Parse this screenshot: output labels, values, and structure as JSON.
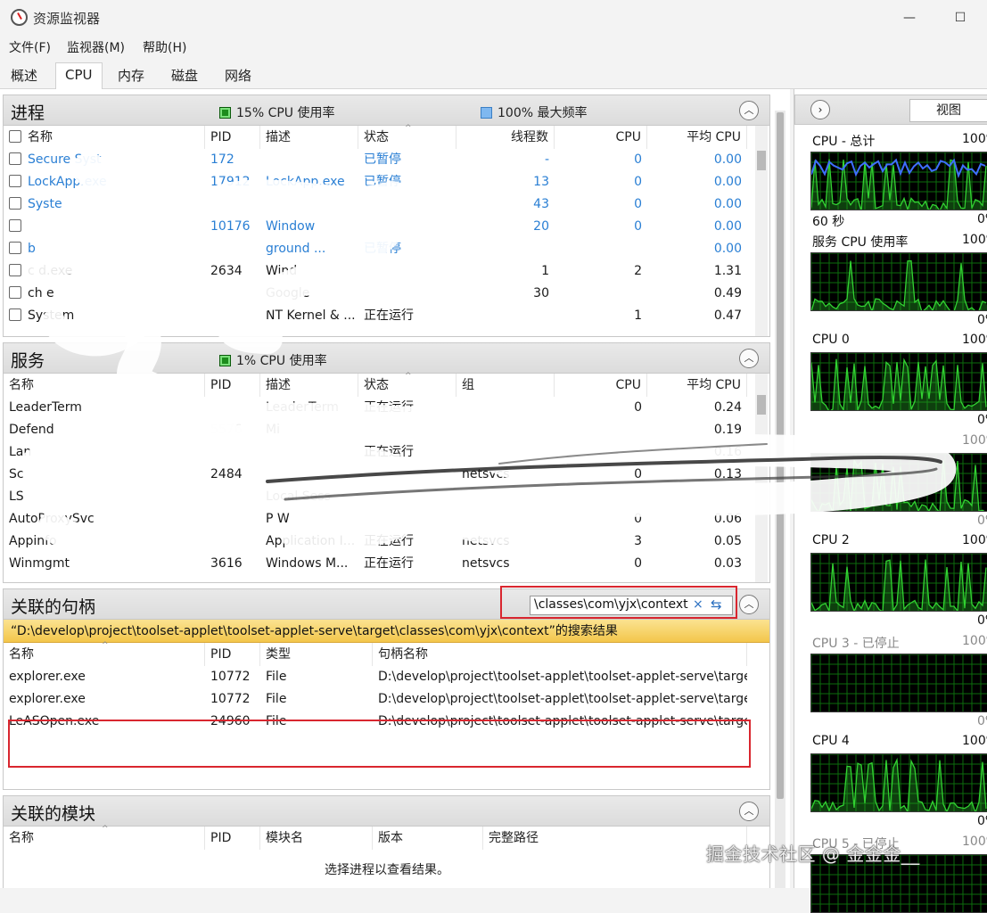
{
  "window": {
    "title": "资源监视器",
    "minimize": "—",
    "maximize": "☐"
  },
  "menu": [
    "文件(F)",
    "监视器(M)",
    "帮助(H)"
  ],
  "tabs": [
    "概述",
    "CPU",
    "内存",
    "磁盘",
    "网络"
  ],
  "active_tab": "CPU",
  "processes": {
    "title": "进程",
    "cpu_usage": "15% CPU 使用率",
    "max_freq": "100% 最大频率",
    "columns": [
      "名称",
      "PID",
      "描述",
      "状态",
      "线程数",
      "CPU",
      "平均 CPU"
    ],
    "rows": [
      {
        "name": "Secure Syst",
        "pid": "172",
        "desc": "",
        "status": "已暂停",
        "threads": "-",
        "cpu": "0",
        "avg": "0.00",
        "suspended": true
      },
      {
        "name": "LockApp.exe",
        "pid": "17912",
        "desc": "LockApp.exe",
        "status": "已暂停",
        "threads": "13",
        "cpu": "0",
        "avg": "0.00",
        "suspended": true
      },
      {
        "name": "Syste",
        "pid": "",
        "desc": "",
        "status": "",
        "threads": "43",
        "cpu": "0",
        "avg": "0.00",
        "suspended": true
      },
      {
        "name": "",
        "pid": "10176",
        "desc": "Window",
        "status": "",
        "threads": "20",
        "cpu": "0",
        "avg": "0.00",
        "suspended": true
      },
      {
        "name": "b",
        "pid": "",
        "desc": "ground ...",
        "status": "已暂停",
        "threads": "",
        "cpu": "",
        "avg": "0.00",
        "suspended": true
      },
      {
        "name": "c   d.exe",
        "pid": "2634",
        "desc": "Wind",
        "status": "",
        "threads": "1",
        "cpu": "2",
        "avg": "1.31",
        "suspended": false
      },
      {
        "name": "ch      e",
        "pid": "",
        "desc": "Google",
        "status": "",
        "threads": "30",
        "cpu": "",
        "avg": "0.49",
        "suspended": false
      },
      {
        "name": "System",
        "pid": "",
        "desc": "NT Kernel & ...",
        "status": "正在运行",
        "threads": "",
        "cpu": "1",
        "avg": "0.47",
        "suspended": false
      }
    ]
  },
  "services": {
    "title": "服务",
    "cpu_usage": "1% CPU 使用率",
    "columns": [
      "名称",
      "PID",
      "描述",
      "状态",
      "组",
      "CPU",
      "平均 CPU"
    ],
    "rows": [
      {
        "name": "LeaderTerm",
        "pid": "",
        "desc": "LeaderTerm",
        "status": "正在运行",
        "group": "",
        "cpu": "0",
        "avg": "0.24"
      },
      {
        "name": "Defend",
        "pid": "5576",
        "desc": "Mi",
        "status": "",
        "group": "",
        "cpu": "",
        "avg": "0.19"
      },
      {
        "name": "Lan",
        "pid": "",
        "desc": "",
        "status": "正在运行",
        "group": "",
        "cpu": "",
        "avg": "0.16"
      },
      {
        "name": "Sc",
        "pid": "2484",
        "desc": "",
        "status": "",
        "group": "netsvcs",
        "cpu": "0",
        "avg": "0.13"
      },
      {
        "name": "LS",
        "pid": "",
        "desc": "Local Sess",
        "status": "",
        "group": "",
        "cpu": "",
        "avg": ""
      },
      {
        "name": "AutoProxySvc",
        "pid": "",
        "desc": "P W",
        "status": "",
        "group": "",
        "cpu": "0",
        "avg": "0.06"
      },
      {
        "name": "Appinfo",
        "pid": "",
        "desc": "Application I...",
        "status": "正在运行",
        "group": "netsvcs",
        "cpu": "3",
        "avg": "0.05"
      },
      {
        "name": "Winmgmt",
        "pid": "3616",
        "desc": "Windows M...",
        "status": "正在运行",
        "group": "netsvcs",
        "cpu": "0",
        "avg": "0.03"
      }
    ]
  },
  "handles": {
    "title": "关联的句柄",
    "search_value": "\\classes\\com\\yjx\\context",
    "clear": "×",
    "refresh": "⇆",
    "result_text": "“D:\\develop\\project\\toolset-applet\\toolset-applet-serve\\target\\classes\\com\\yjx\\context”的搜索结果",
    "columns": [
      "名称",
      "PID",
      "类型",
      "句柄名称"
    ],
    "rows": [
      {
        "name": "explorer.exe",
        "pid": "10772",
        "type": "File",
        "handle": "D:\\develop\\project\\toolset-applet\\toolset-applet-serve\\targe..."
      },
      {
        "name": "explorer.exe",
        "pid": "10772",
        "type": "File",
        "handle": "D:\\develop\\project\\toolset-applet\\toolset-applet-serve\\targe..."
      },
      {
        "name": "LeASOpen.exe",
        "pid": "24960",
        "type": "File",
        "handle": "D:\\develop\\project\\toolset-applet\\toolset-applet-serve\\targe..."
      }
    ]
  },
  "modules": {
    "title": "关联的模块",
    "columns": [
      "名称",
      "PID",
      "模块名",
      "版本",
      "完整路径"
    ],
    "empty_message": "选择进程以查看结果。"
  },
  "right_panel": {
    "nav": "›",
    "view_button": "视图",
    "graphs": [
      {
        "label": "CPU - 总计",
        "max": "100%",
        "min": "0%",
        "stopped": false
      },
      {
        "label": "服务 CPU 使用率",
        "max": "100%",
        "min": "0%",
        "stopped": false
      },
      {
        "label": "CPU 0",
        "max": "100%",
        "min": "0%",
        "stopped": false
      },
      {
        "label": "",
        "max": "100%",
        "min": "0%",
        "stopped": true
      },
      {
        "label": "CPU 2",
        "max": "100%",
        "min": "0%",
        "stopped": false
      },
      {
        "label": "CPU 3 - 已停止",
        "max": "100%",
        "min": "0%",
        "stopped": true
      },
      {
        "label": "CPU 4",
        "max": "100%",
        "min": "0%",
        "stopped": false
      },
      {
        "label": "CPU 5 - 已停止",
        "max": "100%",
        "min": "",
        "stopped": true
      }
    ],
    "time_label": "60 秒"
  },
  "watermark": "掘金技术社区 @ 金金金__",
  "colors": {
    "accent_blue": "#2a7fd4",
    "graph_green": "#32d232",
    "graph_blue": "#3f6fff",
    "highlight_red": "#d9262f",
    "result_yellow": "#f3c64b"
  }
}
